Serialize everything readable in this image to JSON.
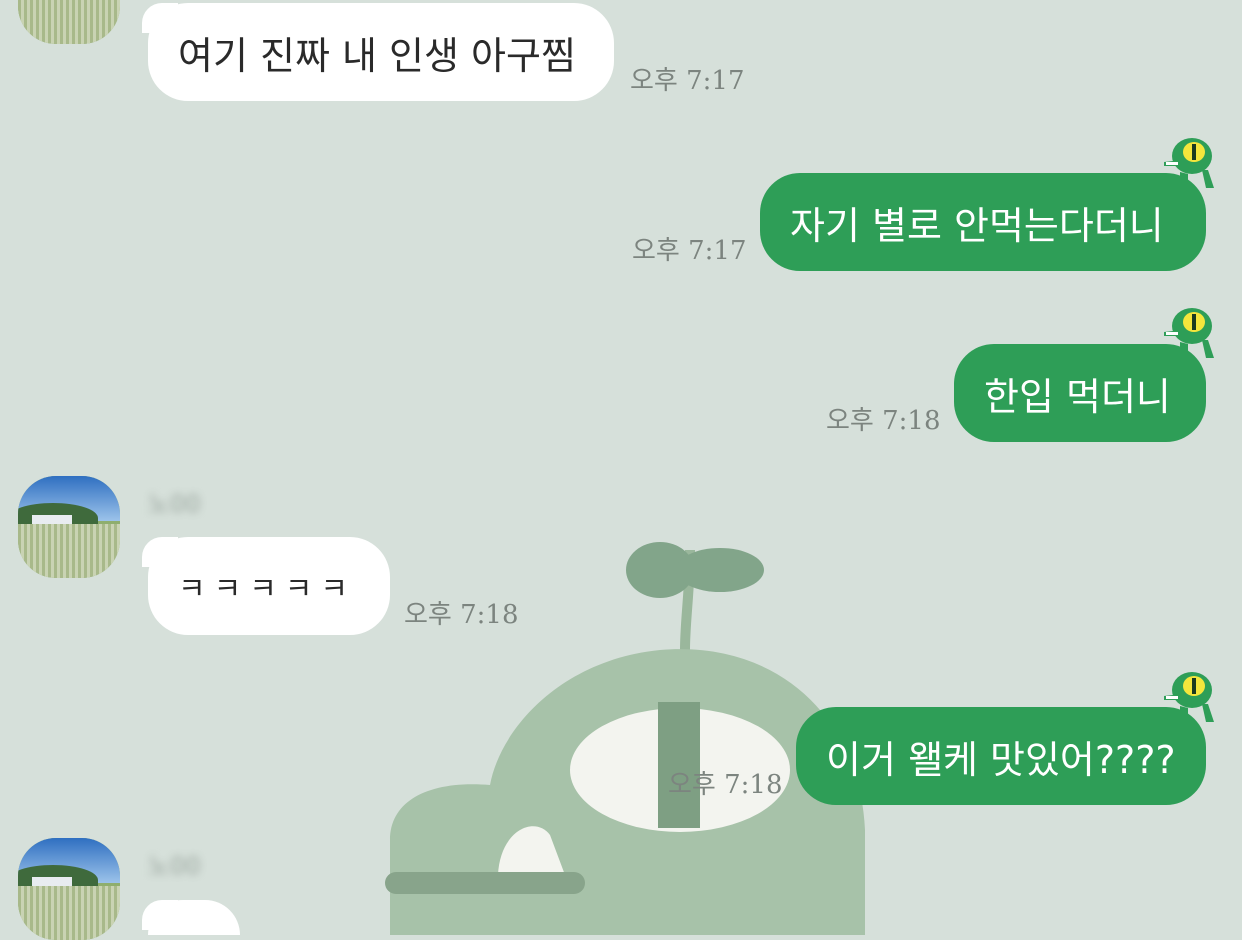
{
  "messages": [
    {
      "side": "in",
      "text": "여기 진짜 내 인생 아구찜",
      "time": "오후 7:17"
    },
    {
      "side": "out",
      "text": "자기 별로 안먹는다더니",
      "time": "오후 7:17"
    },
    {
      "side": "out",
      "text": "한입 먹더니",
      "time": "오후 7:18"
    },
    {
      "side": "in",
      "sender": "노00",
      "text": "ㅋㅋㅋㅋㅋ",
      "time": "오후 7:18"
    },
    {
      "side": "out",
      "text": "이거 왤케 맛있어????",
      "time": "오후 7:18"
    },
    {
      "side": "in",
      "sender": "노00",
      "text": "",
      "time": ""
    }
  ],
  "colors": {
    "background": "#d6e0da",
    "outgoing_bubble": "#2e9e57",
    "incoming_bubble": "#ffffff"
  },
  "icons": {
    "frog": "frog-sticker-icon",
    "avatar": "profile-avatar"
  }
}
